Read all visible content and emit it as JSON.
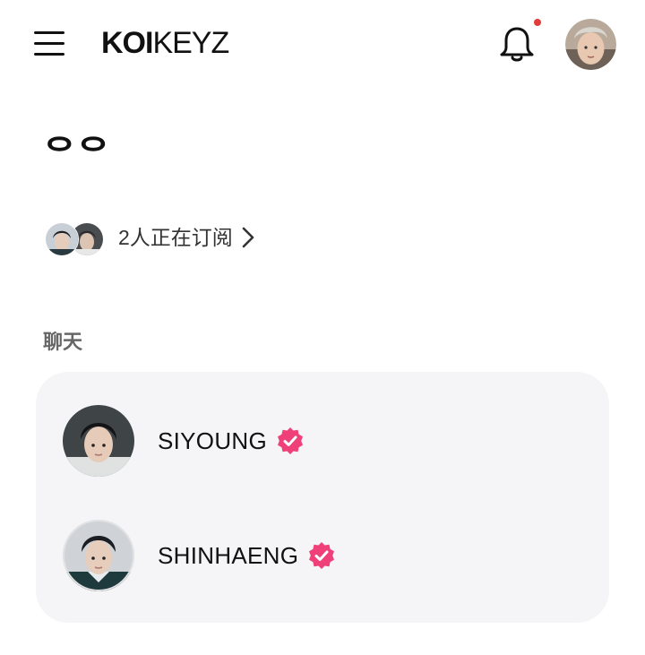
{
  "header": {
    "logo_bold": "KOI",
    "logo_light": "KEYZ",
    "menu_icon": "hamburger-menu-icon",
    "bell_icon": "bell-icon",
    "notification_dot_color": "#e23b3b"
  },
  "page": {
    "title": "ᄋᄋ"
  },
  "subscribers": {
    "text": "2人正在订阅"
  },
  "chat_section": {
    "label": "聊天",
    "items": [
      {
        "name": "SIYOUNG"
      },
      {
        "name": "SHINHAENG"
      }
    ]
  },
  "colors": {
    "accent_pink": "#f0407a",
    "card_bg": "#f5f5f8"
  }
}
